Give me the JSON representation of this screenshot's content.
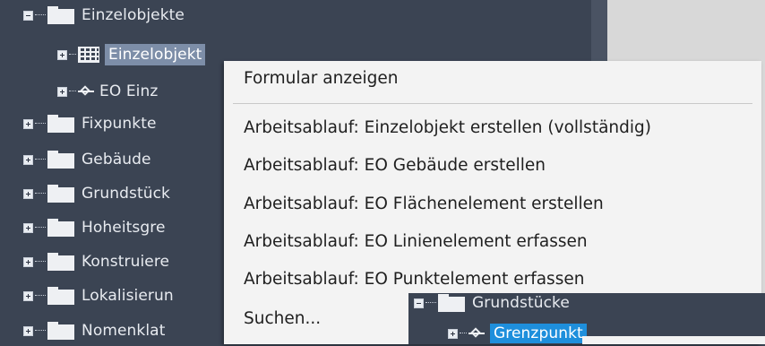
{
  "tree": {
    "items": [
      {
        "label": "Einzelobjekte",
        "expander": "minus"
      },
      {
        "label": "Einzelobjekt",
        "expander": "plus"
      },
      {
        "label": "EO Einz",
        "expander": "plus"
      },
      {
        "label": "Fixpunkte",
        "expander": "plus"
      },
      {
        "label": "Gebäude",
        "expander": "plus"
      },
      {
        "label": "Grundstück",
        "expander": "plus"
      },
      {
        "label": "Hoheitsgre",
        "expander": "plus"
      },
      {
        "label": "Konstruiere",
        "expander": "plus"
      },
      {
        "label": "Lokalisierun",
        "expander": "plus"
      },
      {
        "label": "Nomenklat",
        "expander": "plus"
      }
    ]
  },
  "context_menu": {
    "items": [
      "Formular anzeigen",
      "Arbeitsablauf: Einzelobjekt erstellen (vollständig)",
      "Arbeitsablauf: EO Gebäude erstellen",
      "Arbeitsablauf: EO Flächenelement erstellen",
      "Arbeitsablauf: EO Linienelement erfassen",
      "Arbeitsablauf: EO Punktelement erfassen",
      "Suchen..."
    ]
  },
  "inset_tree": {
    "folder_label": "Grundstücke",
    "child_label": "Grenzpunkt"
  },
  "colors": {
    "tree_bg": "#3b4453",
    "selection": "#7d8ea8",
    "active_selection": "#1e8fdc",
    "menu_bg": "#f3f3f3"
  }
}
